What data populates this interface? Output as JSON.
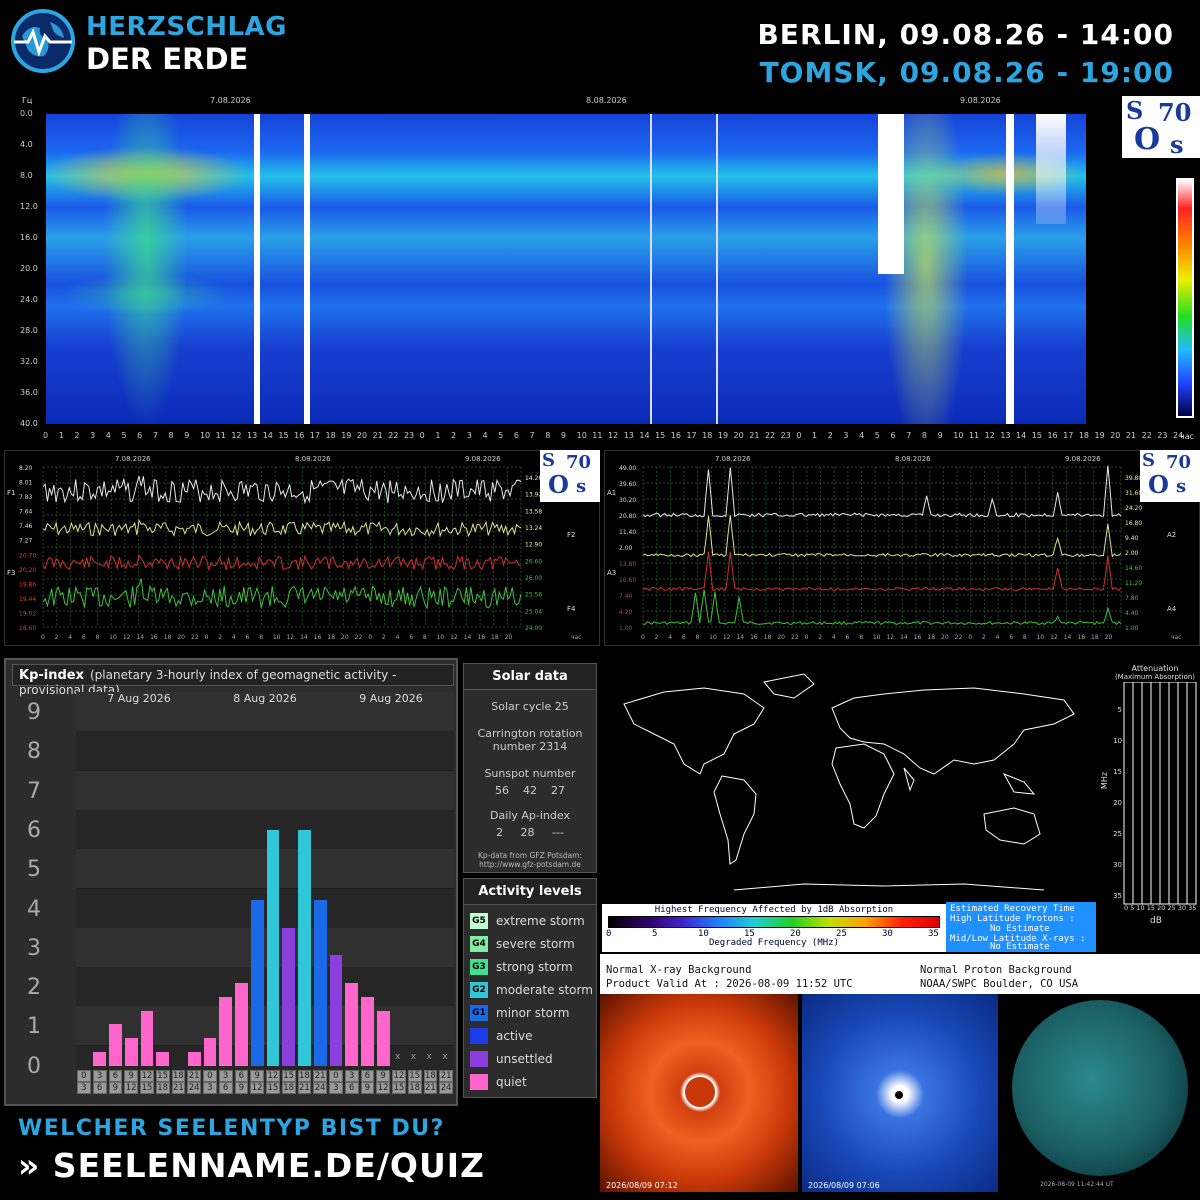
{
  "header": {
    "brand_line1": "HERZSCHLAG",
    "brand_line2": "DER ERDE",
    "berlin_time": "BERLIN, 09.08.26 - 14:00",
    "tomsk_time": "TOMSK, 09.08.26 - 19:00",
    "logo_icon": "globe-heartbeat-icon"
  },
  "spectrogram": {
    "unit_y": "Гц",
    "unit_x": "час",
    "dates": [
      "7.08.2026",
      "8.08.2026",
      "9.08.2026"
    ],
    "y_ticks": [
      "0.0",
      "4.0",
      "8.0",
      "12.0",
      "16.0",
      "20.0",
      "24.0",
      "28.0",
      "32.0",
      "36.0",
      "40.0"
    ],
    "x_ticks": [
      "0",
      "1",
      "2",
      "3",
      "4",
      "5",
      "6",
      "7",
      "8",
      "9",
      "10",
      "11",
      "12",
      "13",
      "14",
      "15",
      "16",
      "17",
      "18",
      "19",
      "20",
      "21",
      "22",
      "23",
      "0",
      "1",
      "2",
      "3",
      "4",
      "5",
      "6",
      "7",
      "8",
      "9",
      "10",
      "11",
      "12",
      "13",
      "14",
      "15",
      "16",
      "17",
      "18",
      "19",
      "20",
      "21",
      "22",
      "23",
      "0",
      "1",
      "2",
      "3",
      "4",
      "5",
      "6",
      "7",
      "8",
      "9",
      "10",
      "11",
      "12",
      "13",
      "14",
      "15",
      "16",
      "17",
      "18",
      "19",
      "20",
      "21",
      "22",
      "23",
      "24"
    ],
    "logo": {
      "s1": "S",
      "num": "70",
      "o": "O",
      "s2": "s"
    }
  },
  "chart_left": {
    "dates": [
      "7.08.2026",
      "8.08.2026",
      "9.08.2026"
    ],
    "left_ticks": [
      "8.20",
      "8.01",
      "7.83",
      "7.64",
      "7.46",
      "7.27",
      "20.70",
      "20.20",
      "19.86",
      "19.44",
      "19.02",
      "18.60"
    ],
    "right_ticks": [
      "14.26",
      "13.92",
      "13.58",
      "13.24",
      "12.90",
      "26.60",
      "26.00",
      "25.56",
      "25.04",
      "24.00"
    ],
    "labels": [
      "F1",
      "F2",
      "F3",
      "F4"
    ],
    "x_ticks": [
      "0",
      "2",
      "4",
      "6",
      "8",
      "10",
      "12",
      "14",
      "16",
      "18",
      "20",
      "22",
      "0",
      "2",
      "4",
      "6",
      "8",
      "10",
      "12",
      "14",
      "16",
      "18",
      "20",
      "22",
      "0",
      "2",
      "4",
      "6",
      "8",
      "10",
      "12",
      "14",
      "16",
      "18",
      "20"
    ],
    "unit_x": "час"
  },
  "chart_right": {
    "dates": [
      "7.08.2026",
      "8.08.2026",
      "9.08.2026"
    ],
    "left_ticks": [
      "49.00",
      "39.60",
      "30.20",
      "20.80",
      "11.40",
      "2.00",
      "13.80",
      "10.60",
      "7.40",
      "4.20",
      "1.00"
    ],
    "right_ticks": [
      "39.80",
      "31.60",
      "24.20",
      "16.80",
      "9.40",
      "2.00",
      "14.60",
      "11.20",
      "7.80",
      "4.40",
      "1.00"
    ],
    "labels": [
      "A1",
      "A2",
      "A3",
      "A4"
    ],
    "unit_x": "час"
  },
  "kp": {
    "title": "Kp-index",
    "subtitle": "(planetary 3-hourly index of geomagnetic activity - provisional data)",
    "levels": [
      "9",
      "8",
      "7",
      "6",
      "5",
      "4",
      "3",
      "2",
      "1",
      "0"
    ],
    "days": [
      "7 Aug 2026",
      "8 Aug 2026",
      "9 Aug 2026"
    ],
    "chart_data": {
      "type": "bar",
      "categories": [
        "0-3",
        "3-6",
        "6-9",
        "9-12",
        "12-15",
        "15-18",
        "18-21",
        "21-24",
        "0-3",
        "3-6",
        "6-9",
        "9-12",
        "12-15",
        "15-18",
        "18-21",
        "21-24",
        "0-3",
        "3-6",
        "6-9",
        "9-12",
        "12-15",
        "15-18",
        "18-21",
        "21-24"
      ],
      "values": [
        0.0,
        0.33,
        1.0,
        0.67,
        1.33,
        0.33,
        0.0,
        0.33,
        0.67,
        1.67,
        2.0,
        4.0,
        5.67,
        3.33,
        5.67,
        4.0,
        2.67,
        2.0,
        1.67,
        1.33,
        null,
        null,
        null,
        null
      ],
      "ylim": [
        0,
        9
      ]
    },
    "bottom_top": [
      "0",
      "3",
      "6",
      "9",
      "12",
      "15",
      "18",
      "21",
      "0",
      "3",
      "6",
      "9",
      "12",
      "15",
      "18",
      "21",
      "0",
      "3",
      "6",
      "9",
      "12",
      "15",
      "18",
      "21"
    ],
    "bottom_bot": [
      "3",
      "6",
      "9",
      "12",
      "15",
      "18",
      "21",
      "24",
      "3",
      "6",
      "9",
      "12",
      "15",
      "18",
      "21",
      "24",
      "3",
      "6",
      "9",
      "12",
      "15",
      "18",
      "21",
      "24"
    ],
    "missing_mark": "x",
    "colors": {
      "quiet": "#ff66cc",
      "unsettled": "#8a3fdc",
      "active": "#1a3ce8",
      "g1": "#1a6ae8",
      "g2": "#30c8d8",
      "g3": "#40e090",
      "g4": "#80f0a0",
      "g5": "#c0ffd0"
    }
  },
  "solar": {
    "title": "Solar data",
    "cycle": "Solar cycle 25",
    "carrington": "Carrington rotation number 2314",
    "sunspot_label": "Sunspot number",
    "sunspot_values": "56    42    27",
    "ap_label": "Daily Ap-index",
    "ap_values": "2     28     ---",
    "source": "Kp-data from GFZ Potsdam: http://www.gfz-potsdam.de"
  },
  "activity": {
    "title": "Activity levels",
    "items": [
      {
        "code": "G5",
        "label": "extreme storm"
      },
      {
        "code": "G4",
        "label": "severe storm"
      },
      {
        "code": "G3",
        "label": "strong storm"
      },
      {
        "code": "G2",
        "label": "moderate storm"
      },
      {
        "code": "G1",
        "label": "minor storm"
      },
      {
        "code": "",
        "label": "active"
      },
      {
        "code": "",
        "label": "unsettled"
      },
      {
        "code": "",
        "label": "quiet"
      }
    ]
  },
  "drap": {
    "atten_title1": "Attenuation",
    "atten_title2": "(Maximum Absorption)",
    "atten_y": [
      "5",
      "10",
      "15",
      "20",
      "25",
      "30",
      "35"
    ],
    "atten_x": "0 5 10 15 20 25 30 35",
    "atten_unit_y": "MHz",
    "atten_unit_x": "dB",
    "legend_title": "Highest Frequency Affected by 1dB Absorption",
    "legend_ticks": [
      "0",
      "5",
      "10",
      "15",
      "20",
      "25",
      "30",
      "35"
    ],
    "legend_xlabel": "Degraded Frequency (MHz)",
    "recovery_title": "Estimated Recovery Time",
    "recovery_l1": "High Latitude Protons :",
    "recovery_l2": "No Estimate",
    "recovery_l3": "Mid/Low Latitude X-rays :",
    "recovery_l4": "No Estimate",
    "xray": "Normal X-ray Background",
    "valid": "Product Valid At : 2026-08-09 11:52 UTC",
    "proton": "Normal Proton Background",
    "noaa": "NOAA/SWPC Boulder, CO USA"
  },
  "images": {
    "lasco_c2_ts": "2026/08/09 07:12",
    "lasco_c3_ts": "2026/08/09 07:06",
    "sdo_ts": "2026-08-09 11:42:44 UT"
  },
  "quiz": {
    "line1": "WELCHER SEELENTYP BIST DU?",
    "line2": "» SEELENNAME.DE/QUIZ"
  }
}
